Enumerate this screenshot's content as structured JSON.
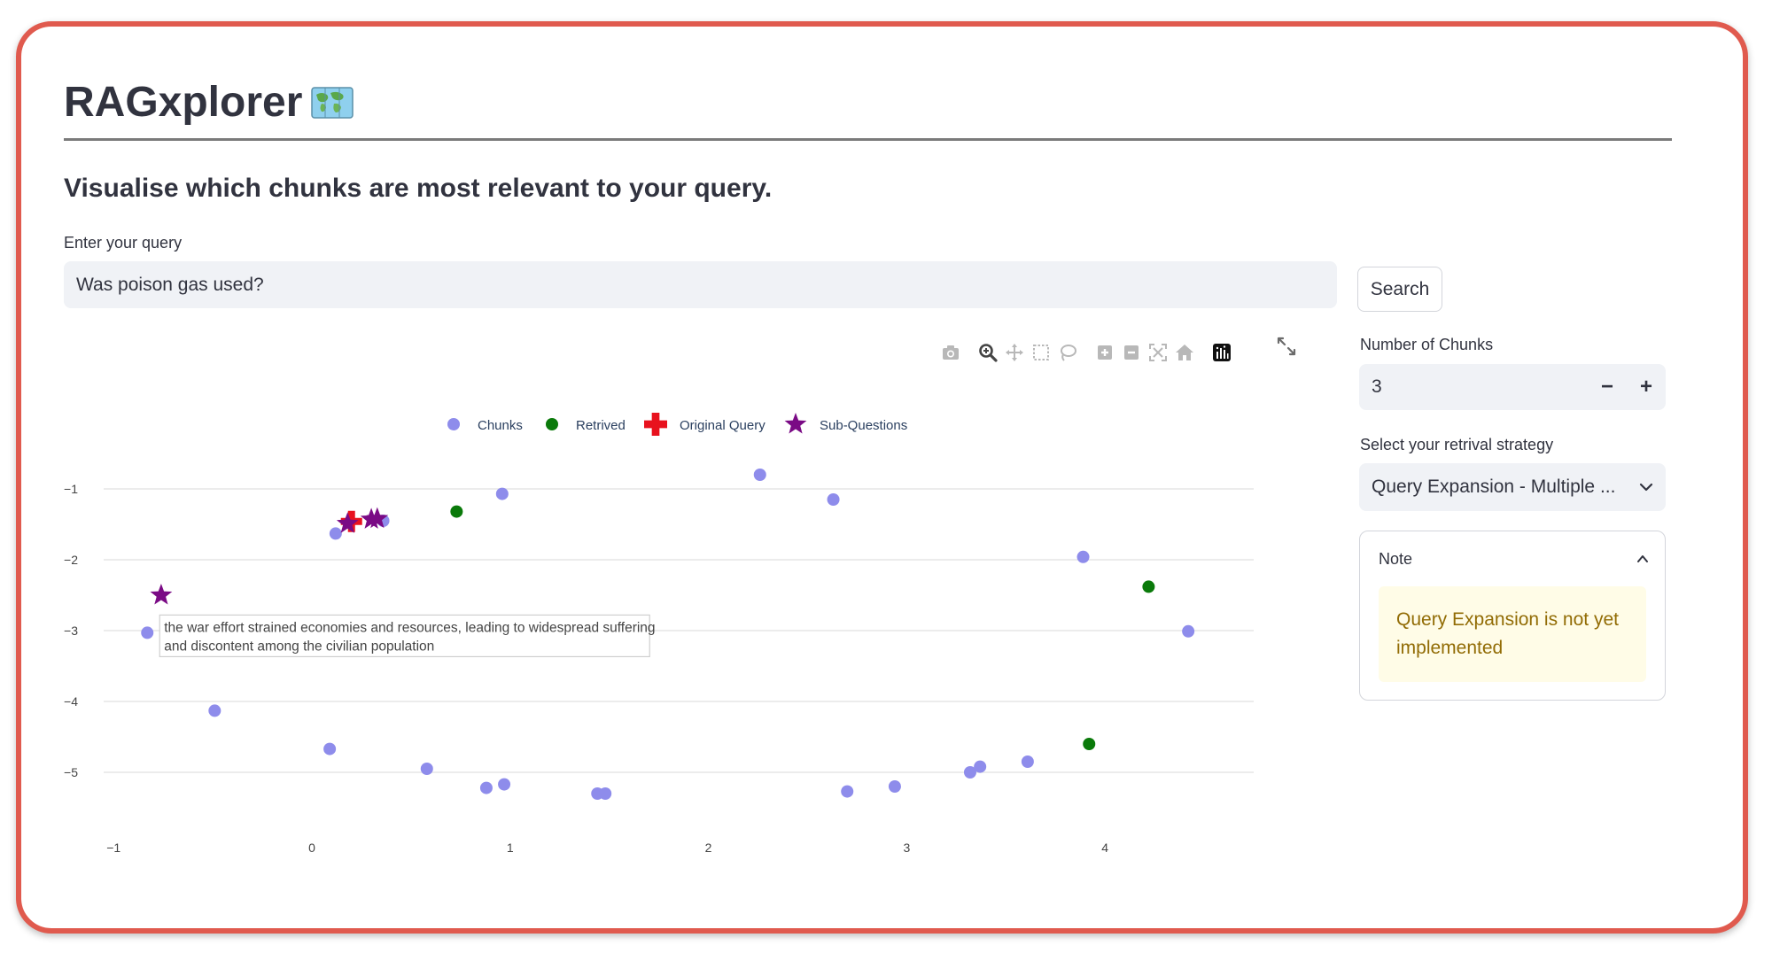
{
  "app": {
    "title": "RAGxplorer",
    "subtitle": "Visualise which chunks are most relevant to your query."
  },
  "query": {
    "label": "Enter your query",
    "value": "Was poison gas used?",
    "search_label": "Search"
  },
  "sidebar": {
    "chunks_label": "Number of Chunks",
    "chunks_value": "3",
    "minus_label": "−",
    "plus_label": "+",
    "strategy_label": "Select your retrival strategy",
    "strategy_value": "Query Expansion - Multiple ...",
    "note_title": "Note",
    "note_text": "Query Expansion is not yet implemented"
  },
  "colors": {
    "chunks": "#8e8ceb",
    "retrived": "#0a7a0a",
    "original_query": "#e8121e",
    "sub_questions": "#7a0a85",
    "note_bg": "#fffce7",
    "note_text": "#926c05",
    "frame_border": "#e05a4e"
  },
  "modebar_icons": [
    "camera-icon",
    "zoom-icon",
    "pan-icon",
    "box-select-icon",
    "lasso-icon",
    "zoom-in-icon",
    "zoom-out-icon",
    "autoscale-icon",
    "reset-axes-icon",
    "plotly-logo-icon"
  ],
  "chart_data": {
    "type": "scatter",
    "legend_position": "top-center",
    "grid": true,
    "xlim": [
      -1.05,
      4.75
    ],
    "ylim": [
      -5.85,
      -0.6
    ],
    "x_ticks": [
      -1,
      0,
      1,
      2,
      3,
      4
    ],
    "y_ticks": [
      -1,
      -2,
      -3,
      -4,
      -5
    ],
    "series": [
      {
        "name": "Chunks",
        "marker": "circle",
        "color": "#8e8ceb",
        "points": [
          {
            "x": -0.83,
            "y": -3.03
          },
          {
            "x": -0.49,
            "y": -4.13
          },
          {
            "x": 0.12,
            "y": -1.63
          },
          {
            "x": 0.36,
            "y": -1.45
          },
          {
            "x": 0.09,
            "y": -4.67
          },
          {
            "x": 0.58,
            "y": -4.95
          },
          {
            "x": 0.88,
            "y": -5.22
          },
          {
            "x": 0.97,
            "y": -5.17
          },
          {
            "x": 0.96,
            "y": -1.07
          },
          {
            "x": 1.44,
            "y": -5.3
          },
          {
            "x": 1.48,
            "y": -5.3
          },
          {
            "x": 2.26,
            "y": -0.8
          },
          {
            "x": 2.63,
            "y": -1.15
          },
          {
            "x": 2.7,
            "y": -5.27
          },
          {
            "x": 2.94,
            "y": -5.2
          },
          {
            "x": 3.32,
            "y": -5.0
          },
          {
            "x": 3.37,
            "y": -4.92
          },
          {
            "x": 3.61,
            "y": -4.85
          },
          {
            "x": 3.89,
            "y": -1.96
          },
          {
            "x": 4.42,
            "y": -3.01
          }
        ]
      },
      {
        "name": "Retrived",
        "marker": "circle",
        "color": "#0a7a0a",
        "points": [
          {
            "x": 0.73,
            "y": -1.32
          },
          {
            "x": 4.22,
            "y": -2.38
          },
          {
            "x": 3.92,
            "y": -4.6
          }
        ]
      },
      {
        "name": "Original Query",
        "marker": "cross",
        "color": "#e8121e",
        "points": [
          {
            "x": 0.2,
            "y": -1.46
          }
        ]
      },
      {
        "name": "Sub-Questions",
        "marker": "star",
        "color": "#7a0a85",
        "points": [
          {
            "x": -0.76,
            "y": -2.5
          },
          {
            "x": 0.18,
            "y": -1.49
          },
          {
            "x": 0.3,
            "y": -1.43
          },
          {
            "x": 0.33,
            "y": -1.42
          }
        ]
      }
    ],
    "hover": {
      "x": -0.83,
      "y": -3.03,
      "lines": [
        "the war effort strained economies and resources, leading to widespread suffering",
        "and discontent among the civilian population"
      ]
    }
  }
}
